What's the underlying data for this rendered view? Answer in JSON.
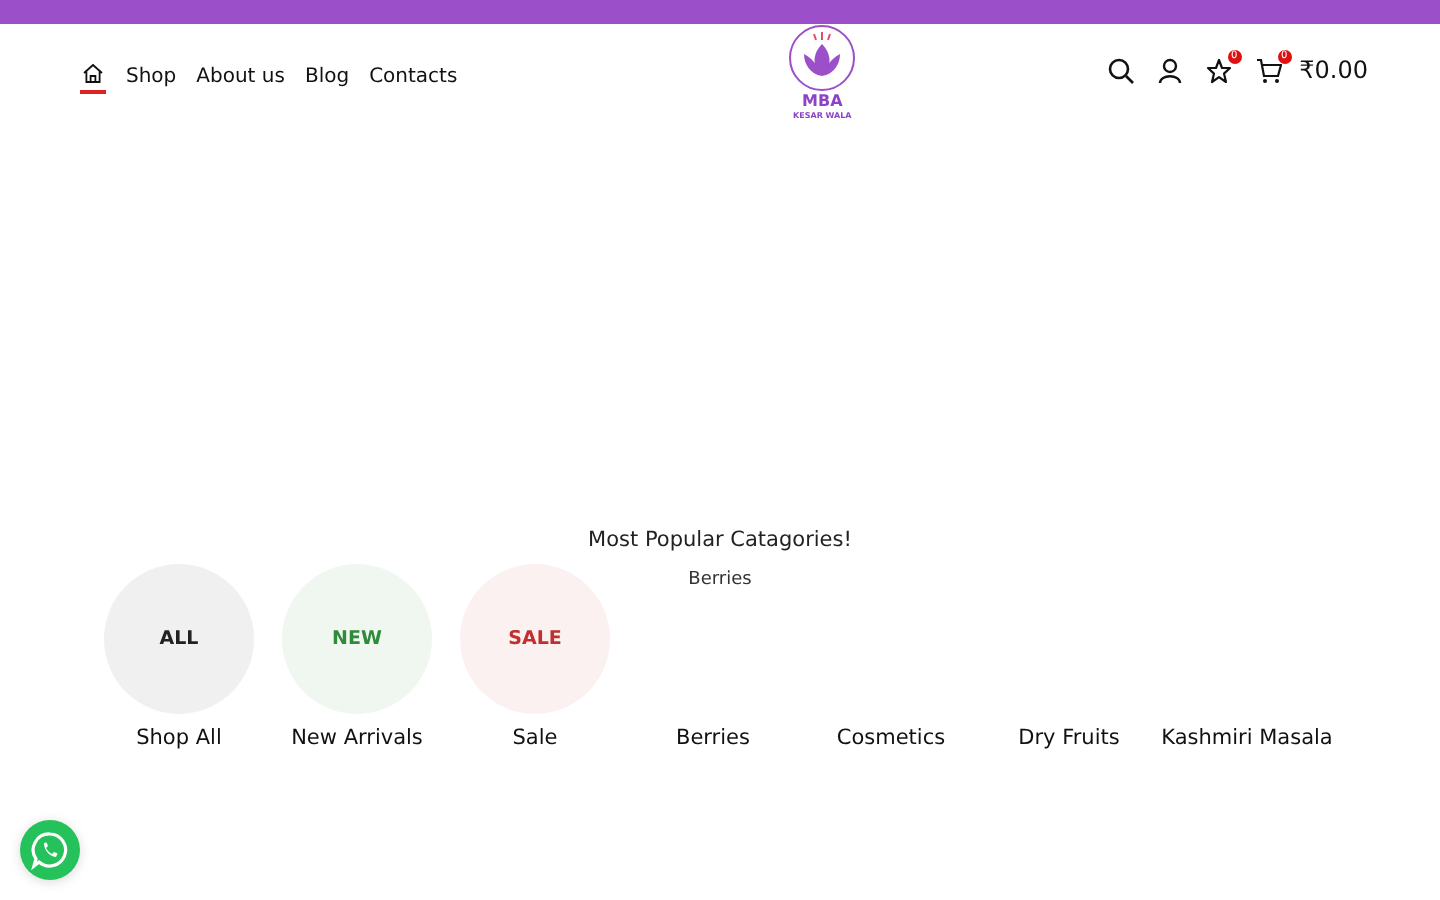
{
  "nav": [
    {
      "kind": "home",
      "selected": true
    },
    {
      "kind": "link",
      "label": "Shop",
      "selected": false
    },
    {
      "kind": "link",
      "label": "About us",
      "selected": false
    },
    {
      "kind": "link",
      "label": "Blog",
      "selected": false
    },
    {
      "kind": "link",
      "label": "Contacts",
      "selected": false
    }
  ],
  "logo": {
    "title": "MBA",
    "subtitle": "KESAR WALA"
  },
  "header_actions": {
    "wishlist_count": "0",
    "cart_count": "0",
    "cart_total": "₹0.00"
  },
  "section": {
    "title": "Most Popular Catagories!",
    "image_alt": "Berries"
  },
  "categories": [
    {
      "kind": "circle",
      "badge": "ALL",
      "color": "#222222",
      "label": "Shop All"
    },
    {
      "kind": "circle",
      "badge": "NEW",
      "color": "#2e8b3a",
      "label": "New Arrivals"
    },
    {
      "kind": "circle",
      "badge": "SALE",
      "color": "#c0302f",
      "label": "Sale"
    },
    {
      "kind": "plain",
      "label": "Berries"
    },
    {
      "kind": "plain",
      "label": "Cosmetics"
    },
    {
      "kind": "plain",
      "label": "Dry Fruits"
    },
    {
      "kind": "plain",
      "label": "Kashmiri Masala"
    }
  ]
}
